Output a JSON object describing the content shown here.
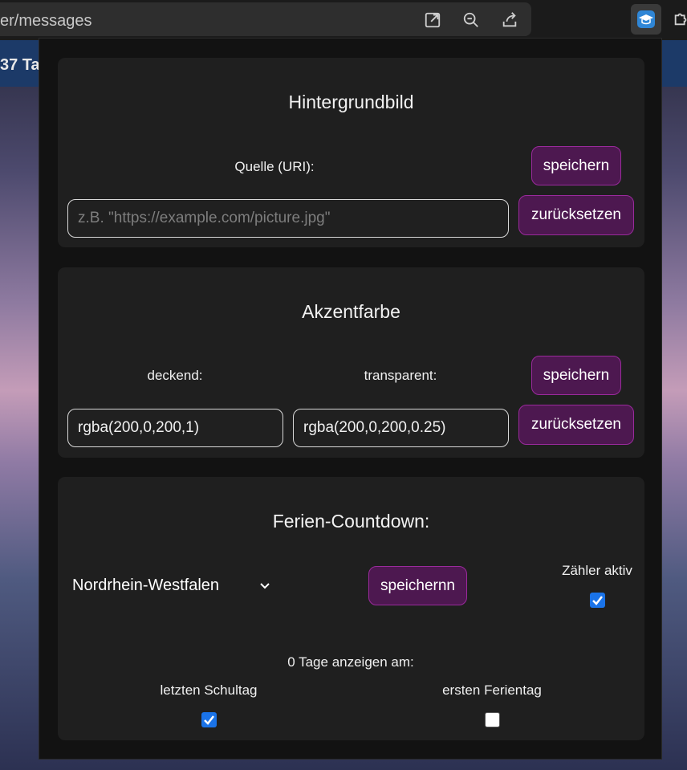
{
  "browser": {
    "url_fragment": "er/messages",
    "icons": [
      "open-in-new-icon",
      "zoom-out-icon",
      "share-icon",
      "graduation-cap-icon",
      "puzzle-icon"
    ]
  },
  "background": {
    "tab_text": "37 Ta"
  },
  "wallpaper": {
    "title": "Hintergrundbild",
    "source_label": "Quelle (URI):",
    "placeholder": "z.B. \"https://example.com/picture.jpg\"",
    "value": "",
    "save_label": "speichern",
    "reset_label": "zurücksetzen"
  },
  "accent": {
    "title": "Akzentfarbe",
    "opaque_label": "deckend:",
    "transparent_label": "transparent:",
    "opaque_value": "rgba(200,0,200,1)",
    "transparent_value": "rgba(200,0,200,0.25)",
    "save_label": "speichern",
    "reset_label": "zurücksetzen"
  },
  "countdown": {
    "title": "Ferien-Countdown:",
    "state_selected": "Nordrhein-Westfalen",
    "save_label": "speichernn",
    "active_label": "Zähler aktiv",
    "active_checked": true,
    "zero_days_label": "0 Tage anzeigen am:",
    "last_school_day_label": "letzten Schultag",
    "last_school_day_checked": true,
    "first_holiday_label": "ersten Ferientag",
    "first_holiday_checked": false
  },
  "colors": {
    "accent_button": "#4d1850",
    "accent_border": "#9a2a9c",
    "checkbox_on": "#1a73e8",
    "card_bg": "#1f1f1f"
  }
}
